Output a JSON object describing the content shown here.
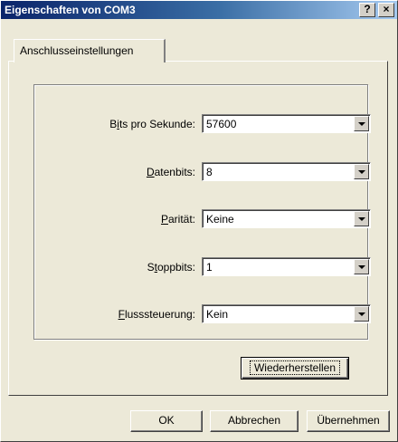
{
  "window": {
    "title": "Eigenschaften von COM3",
    "help_button": "?",
    "close_button": "×"
  },
  "tabs": [
    {
      "label": "Anschlusseinstellungen",
      "active": true
    }
  ],
  "fields": [
    {
      "label": "Bits pro Sekunde:",
      "mnemonic_index": 1,
      "value": "57600"
    },
    {
      "label": "Datenbits:",
      "mnemonic_index": 0,
      "value": "8"
    },
    {
      "label": "Parität:",
      "mnemonic_index": 0,
      "value": "Keine"
    },
    {
      "label": "Stoppbits:",
      "mnemonic_index": 1,
      "value": "1"
    },
    {
      "label": "Flusssteuerung:",
      "mnemonic_index": 0,
      "value": "Kein"
    }
  ],
  "buttons": {
    "restore": "Wiederherstellen",
    "ok": "OK",
    "cancel": "Abbrechen",
    "apply": "Übernehmen"
  }
}
